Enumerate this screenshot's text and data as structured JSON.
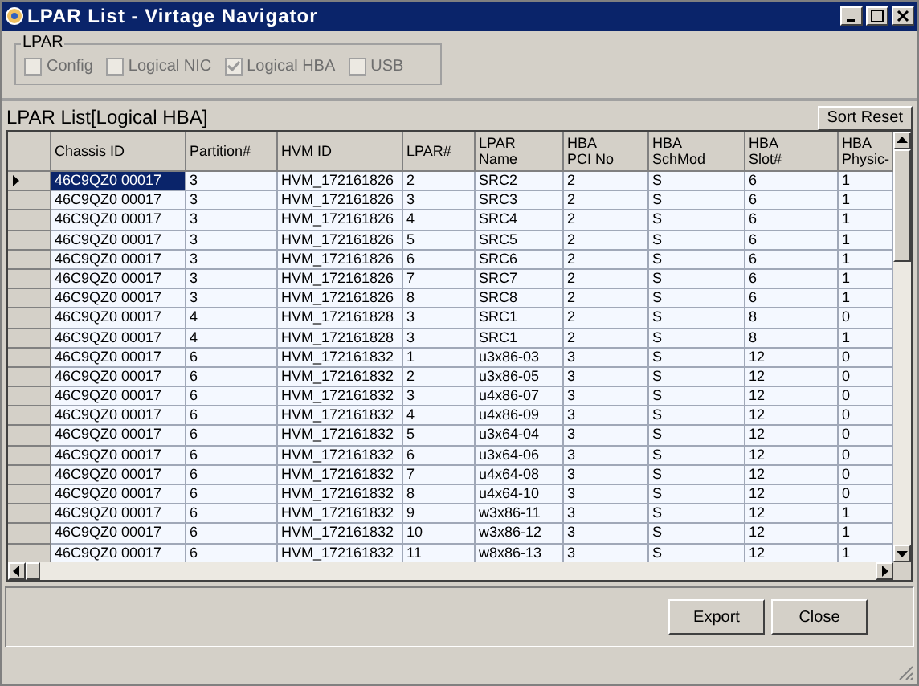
{
  "window": {
    "title": "LPAR List - Virtage Navigator"
  },
  "filter_group": {
    "title": "LPAR",
    "options": [
      {
        "label": "Config",
        "checked": false,
        "disabled": true
      },
      {
        "label": "Logical NIC",
        "checked": false,
        "disabled": true
      },
      {
        "label": "Logical HBA",
        "checked": true,
        "disabled": true
      },
      {
        "label": "USB",
        "checked": false,
        "disabled": true
      }
    ]
  },
  "list_title": "LPAR List[Logical HBA]",
  "sort_reset_button": "Sort Reset",
  "table": {
    "columns": [
      "Chassis ID",
      "Partition#",
      "HVM ID",
      "LPAR#",
      "LPAR\nName",
      "HBA\nPCI No",
      "HBA\nSchMod",
      "HBA\nSlot#",
      "HBA\nPhysic-"
    ],
    "rows": [
      {
        "selected": true,
        "cells": [
          "46C9QZ0 00017",
          "3",
          "HVM_172161826",
          "2",
          "SRC2",
          "2",
          "S",
          "6",
          "1"
        ]
      },
      {
        "selected": false,
        "cells": [
          "46C9QZ0 00017",
          "3",
          "HVM_172161826",
          "3",
          "SRC3",
          "2",
          "S",
          "6",
          "1"
        ]
      },
      {
        "selected": false,
        "cells": [
          "46C9QZ0 00017",
          "3",
          "HVM_172161826",
          "4",
          "SRC4",
          "2",
          "S",
          "6",
          "1"
        ]
      },
      {
        "selected": false,
        "cells": [
          "46C9QZ0 00017",
          "3",
          "HVM_172161826",
          "5",
          "SRC5",
          "2",
          "S",
          "6",
          "1"
        ]
      },
      {
        "selected": false,
        "cells": [
          "46C9QZ0 00017",
          "3",
          "HVM_172161826",
          "6",
          "SRC6",
          "2",
          "S",
          "6",
          "1"
        ]
      },
      {
        "selected": false,
        "cells": [
          "46C9QZ0 00017",
          "3",
          "HVM_172161826",
          "7",
          "SRC7",
          "2",
          "S",
          "6",
          "1"
        ]
      },
      {
        "selected": false,
        "cells": [
          "46C9QZ0 00017",
          "3",
          "HVM_172161826",
          "8",
          "SRC8",
          "2",
          "S",
          "6",
          "1"
        ]
      },
      {
        "selected": false,
        "cells": [
          "46C9QZ0 00017",
          "4",
          "HVM_172161828",
          "3",
          "SRC1",
          "2",
          "S",
          "8",
          "0"
        ]
      },
      {
        "selected": false,
        "cells": [
          "46C9QZ0 00017",
          "4",
          "HVM_172161828",
          "3",
          "SRC1",
          "2",
          "S",
          "8",
          "1"
        ]
      },
      {
        "selected": false,
        "cells": [
          "46C9QZ0 00017",
          "6",
          "HVM_172161832",
          "1",
          "u3x86-03",
          "3",
          "S",
          "12",
          "0"
        ]
      },
      {
        "selected": false,
        "cells": [
          "46C9QZ0 00017",
          "6",
          "HVM_172161832",
          "2",
          "u3x86-05",
          "3",
          "S",
          "12",
          "0"
        ]
      },
      {
        "selected": false,
        "cells": [
          "46C9QZ0 00017",
          "6",
          "HVM_172161832",
          "3",
          "u4x86-07",
          "3",
          "S",
          "12",
          "0"
        ]
      },
      {
        "selected": false,
        "cells": [
          "46C9QZ0 00017",
          "6",
          "HVM_172161832",
          "4",
          "u4x86-09",
          "3",
          "S",
          "12",
          "0"
        ]
      },
      {
        "selected": false,
        "cells": [
          "46C9QZ0 00017",
          "6",
          "HVM_172161832",
          "5",
          "u3x64-04",
          "3",
          "S",
          "12",
          "0"
        ]
      },
      {
        "selected": false,
        "cells": [
          "46C9QZ0 00017",
          "6",
          "HVM_172161832",
          "6",
          "u3x64-06",
          "3",
          "S",
          "12",
          "0"
        ]
      },
      {
        "selected": false,
        "cells": [
          "46C9QZ0 00017",
          "6",
          "HVM_172161832",
          "7",
          "u4x64-08",
          "3",
          "S",
          "12",
          "0"
        ]
      },
      {
        "selected": false,
        "cells": [
          "46C9QZ0 00017",
          "6",
          "HVM_172161832",
          "8",
          "u4x64-10",
          "3",
          "S",
          "12",
          "0"
        ]
      },
      {
        "selected": false,
        "cells": [
          "46C9QZ0 00017",
          "6",
          "HVM_172161832",
          "9",
          "w3x86-11",
          "3",
          "S",
          "12",
          "1"
        ]
      },
      {
        "selected": false,
        "cells": [
          "46C9QZ0 00017",
          "6",
          "HVM_172161832",
          "10",
          "w3x86-12",
          "3",
          "S",
          "12",
          "1"
        ]
      },
      {
        "selected": false,
        "cells": [
          "46C9QZ0 00017",
          "6",
          "HVM_172161832",
          "11",
          "w8x86-13",
          "3",
          "S",
          "12",
          "1"
        ]
      }
    ]
  },
  "buttons": [
    "Export",
    "Close"
  ]
}
